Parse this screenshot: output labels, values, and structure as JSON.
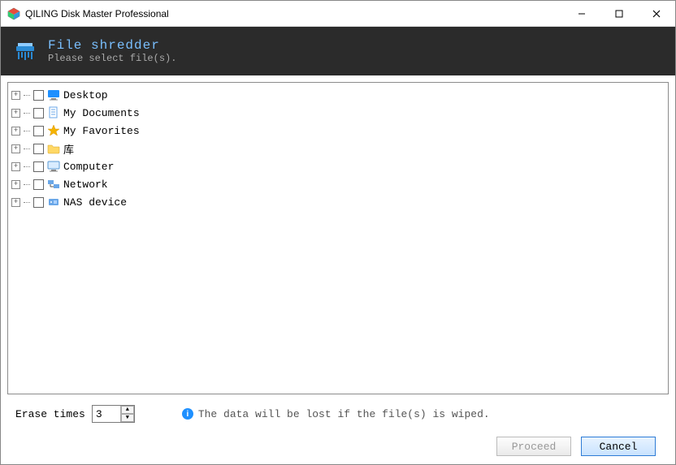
{
  "titlebar": {
    "title": "QILING Disk Master Professional"
  },
  "banner": {
    "headline": "File shredder",
    "subline": "Please select file(s)."
  },
  "tree": {
    "nodes": [
      {
        "label": "Desktop",
        "icon": "desktop"
      },
      {
        "label": "My Documents",
        "icon": "documents"
      },
      {
        "label": "My Favorites",
        "icon": "favorites"
      },
      {
        "label": "库",
        "icon": "library"
      },
      {
        "label": "Computer",
        "icon": "computer"
      },
      {
        "label": "Network",
        "icon": "network"
      },
      {
        "label": "NAS device",
        "icon": "nas"
      }
    ]
  },
  "controls": {
    "erase_label": "Erase times",
    "erase_value": "3",
    "info_text": "The data will be lost if the file(s) is wiped.",
    "proceed": "Proceed",
    "cancel": "Cancel"
  }
}
